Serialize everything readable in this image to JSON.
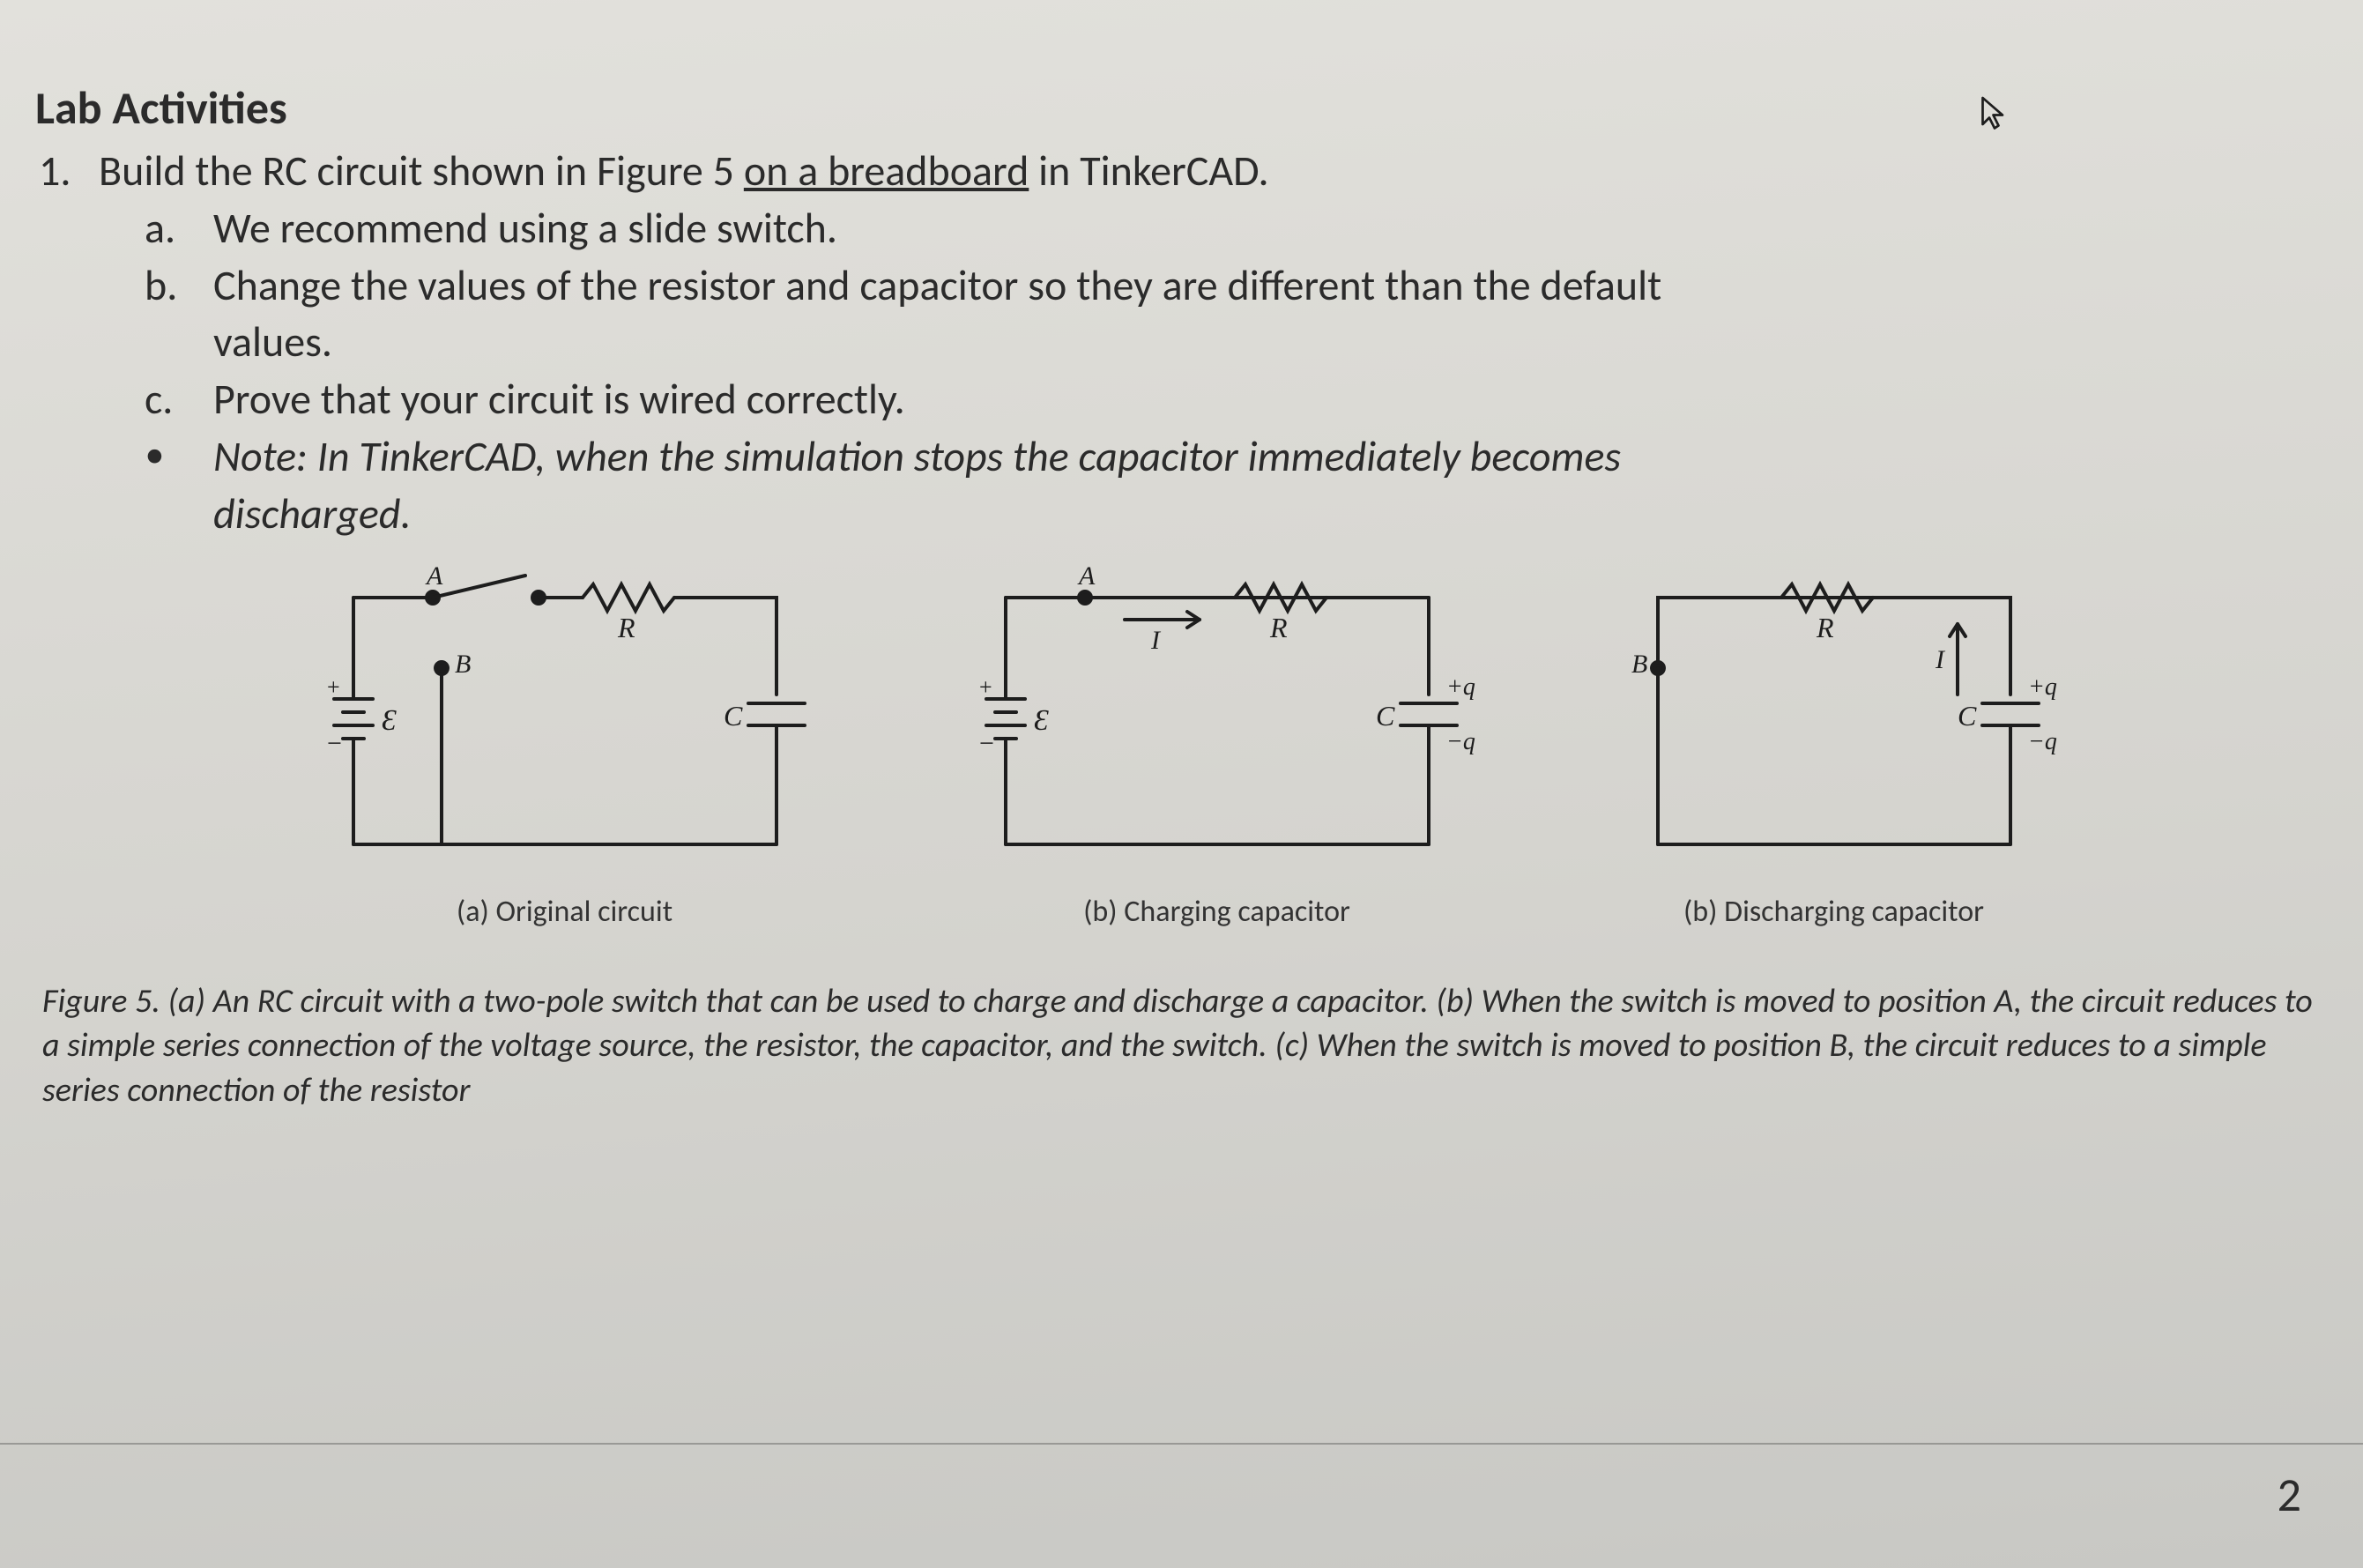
{
  "sectionTitle": "Lab Activities",
  "item1": {
    "marker": "1.",
    "pre": "Build the RC circuit shown in Figure 5 ",
    "underlined": "on a breadboard",
    "post": " in TinkerCAD."
  },
  "sub": {
    "a": {
      "marker": "a.",
      "text": "We recommend using a slide switch."
    },
    "b": {
      "marker": "b.",
      "text_line1": "Change the values of the resistor and capacitor so they are different than the default",
      "text_line2": "values."
    },
    "c": {
      "marker": "c.",
      "text": "Prove that your circuit is wired correctly."
    },
    "note": {
      "marker": "•",
      "text_line1": "Note: In TinkerCAD, when the simulation stops the capacitor immediately becomes",
      "text_line2": "discharged."
    }
  },
  "circuits": {
    "a": {
      "caption": "(a) Original circuit",
      "A": "A",
      "B": "B",
      "R": "R",
      "C": "C",
      "emf": "Ɛ"
    },
    "b": {
      "caption": "(b) Charging capacitor",
      "A": "A",
      "I": "I",
      "R": "R",
      "C": "C",
      "emf": "Ɛ",
      "qplus": "+q",
      "qminus": "−q"
    },
    "c": {
      "caption": "(b) Discharging capacitor",
      "B": "B",
      "I": "I",
      "R": "R",
      "C": "C",
      "qplus": "+q",
      "qminus": "−q"
    }
  },
  "figureCaption": "Figure 5. (a) An RC circuit with a two-pole switch that can be used to charge and discharge a capacitor. (b) When the switch is moved to position A, the circuit reduces to a simple series connection of the voltage source, the resistor, the capacitor, and the switch. (c) When the switch is moved to position B, the circuit reduces to a simple series connection of the resistor",
  "pageNumber": "2"
}
